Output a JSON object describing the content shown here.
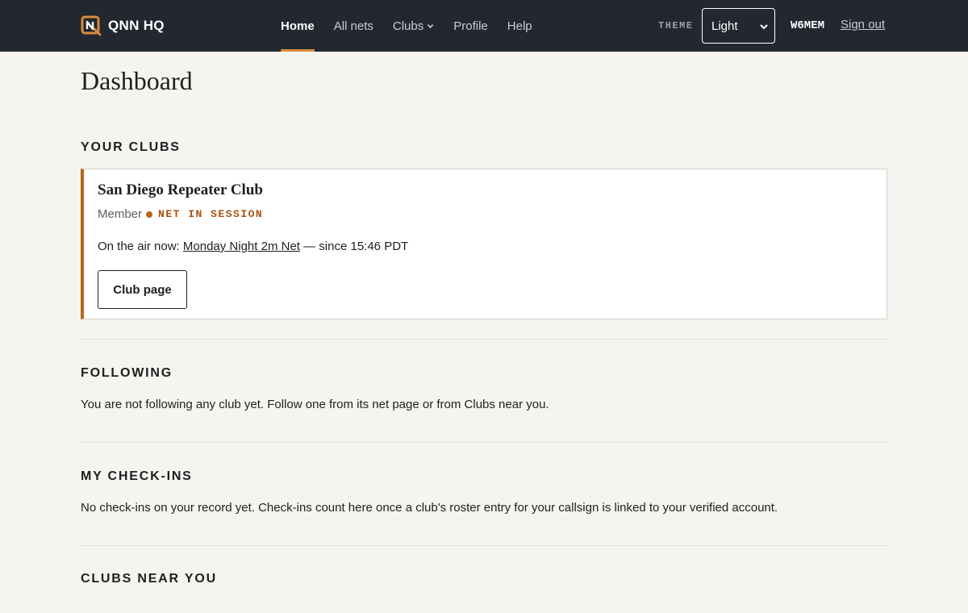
{
  "header": {
    "brand": "QNN HQ",
    "nav": [
      {
        "label": "Home",
        "active": true
      },
      {
        "label": "All nets"
      },
      {
        "label": "Clubs",
        "dropdown": true
      },
      {
        "label": "Profile"
      },
      {
        "label": "Help"
      }
    ],
    "theme_label": "THEME",
    "theme_value": "Light",
    "callsign": "W6MEM",
    "sign_out": "Sign out"
  },
  "page_title": "Dashboard",
  "your_clubs": {
    "heading": "YOUR CLUBS",
    "clubs": [
      {
        "name": "San Diego Repeater Club",
        "role": "Member",
        "status": "NET IN SESSION",
        "on_air_prefix": "On the air now: ",
        "net_name": "Monday Night 2m Net",
        "since": " — since 15:46 PDT",
        "button": "Club page"
      }
    ]
  },
  "following": {
    "heading": "FOLLOWING",
    "text": "You are not following any club yet. Follow one from its net page or from Clubs near you."
  },
  "checkins": {
    "heading": "MY CHECK-INS",
    "text": "No check-ins on your record yet. Check-ins count here once a club's roster entry for your callsign is linked to your verified account."
  },
  "nearby": {
    "heading": "CLUBS NEAR YOU"
  },
  "colors": {
    "topbar": "#232830",
    "accent": "#d98a3a",
    "status": "#b8651b",
    "background": "#f5f4f0"
  }
}
